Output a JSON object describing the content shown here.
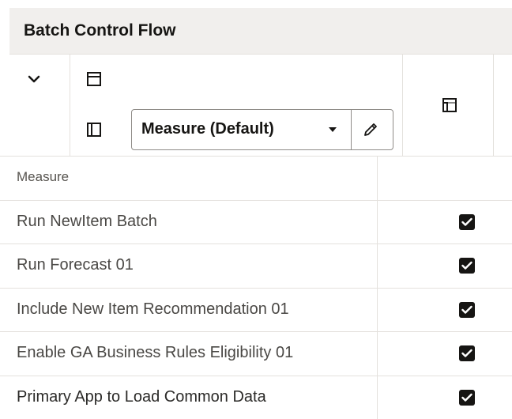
{
  "panel": {
    "title": "Batch Control Flow"
  },
  "toolbar": {
    "collapse_icon": "chevron-down-icon",
    "row_layout_icon": "panel-top-icon",
    "column_layout_icon": "panel-left-icon",
    "pivot_icon": "pivot-icon",
    "measure_select": {
      "value": "Measure (Default)",
      "caret_icon": "caret-down-icon",
      "edit_icon": "pencil-icon"
    }
  },
  "grid": {
    "header_label": "Measure",
    "rows": [
      {
        "label": "Run NewItem Batch",
        "checked": true
      },
      {
        "label": "Run Forecast 01",
        "checked": true
      },
      {
        "label": "Include New Item Recommendation 01",
        "checked": true
      },
      {
        "label": "Enable GA Business Rules Eligibility 01",
        "checked": true
      },
      {
        "label": "Primary App to Load Common Data",
        "checked": true
      }
    ]
  },
  "colors": {
    "header_bg": "#f1efed",
    "border": "#e4e1dd",
    "checkbox": "#161513"
  }
}
